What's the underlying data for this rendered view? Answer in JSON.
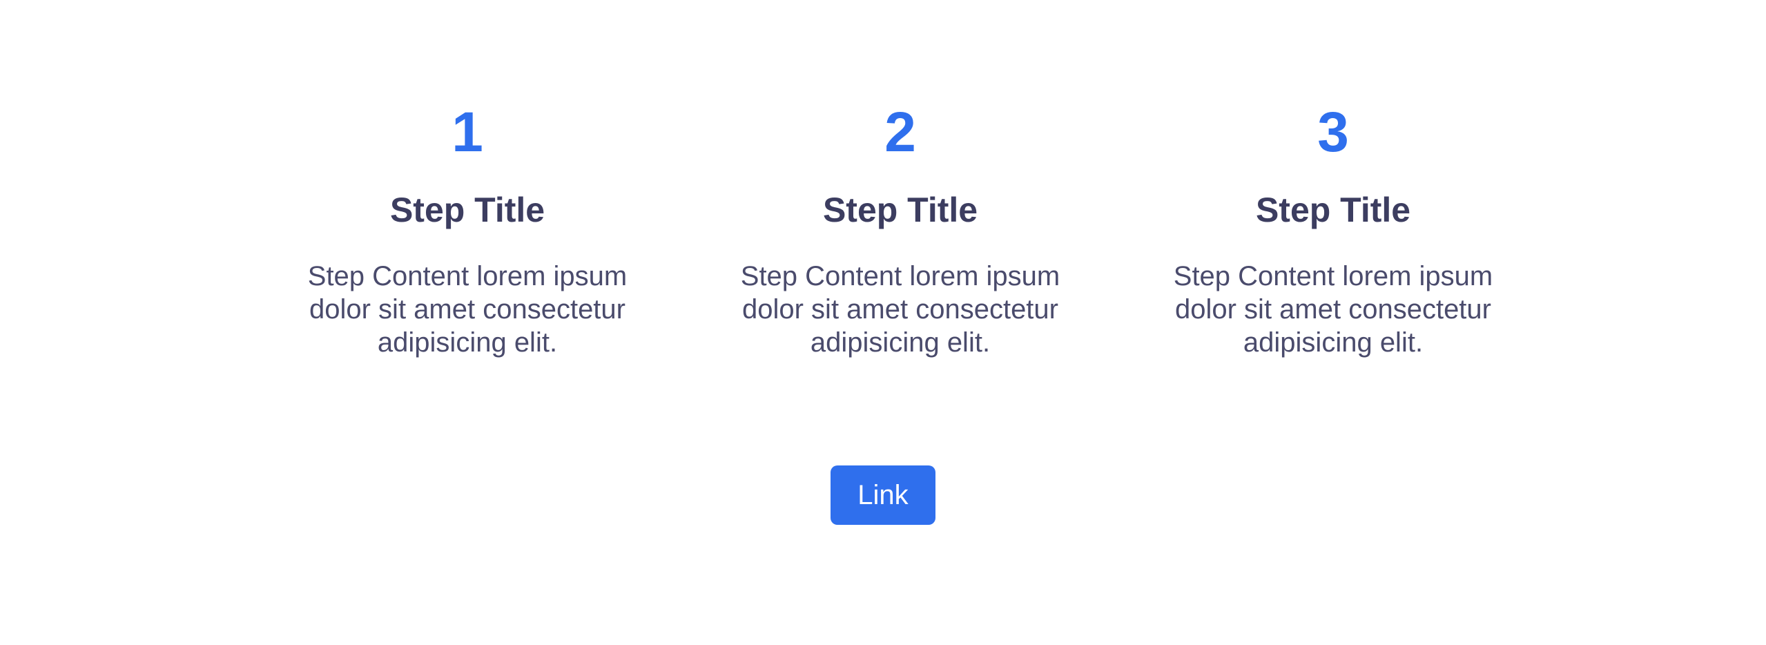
{
  "steps": [
    {
      "number": "1",
      "title": "Step Title",
      "content": "Step Content lorem ipsum dolor sit amet consectetur adipisicing elit."
    },
    {
      "number": "2",
      "title": "Step Title",
      "content": "Step Content lorem ipsum dolor sit amet consectetur adipisicing elit."
    },
    {
      "number": "3",
      "title": "Step Title",
      "content": "Step Content lorem ipsum dolor sit amet consectetur adipisicing elit."
    }
  ],
  "cta": {
    "label": "Link"
  },
  "colors": {
    "accent": "#2f6fed",
    "title": "#3c3d60",
    "body": "#4a4b6c",
    "background": "#ffffff"
  }
}
